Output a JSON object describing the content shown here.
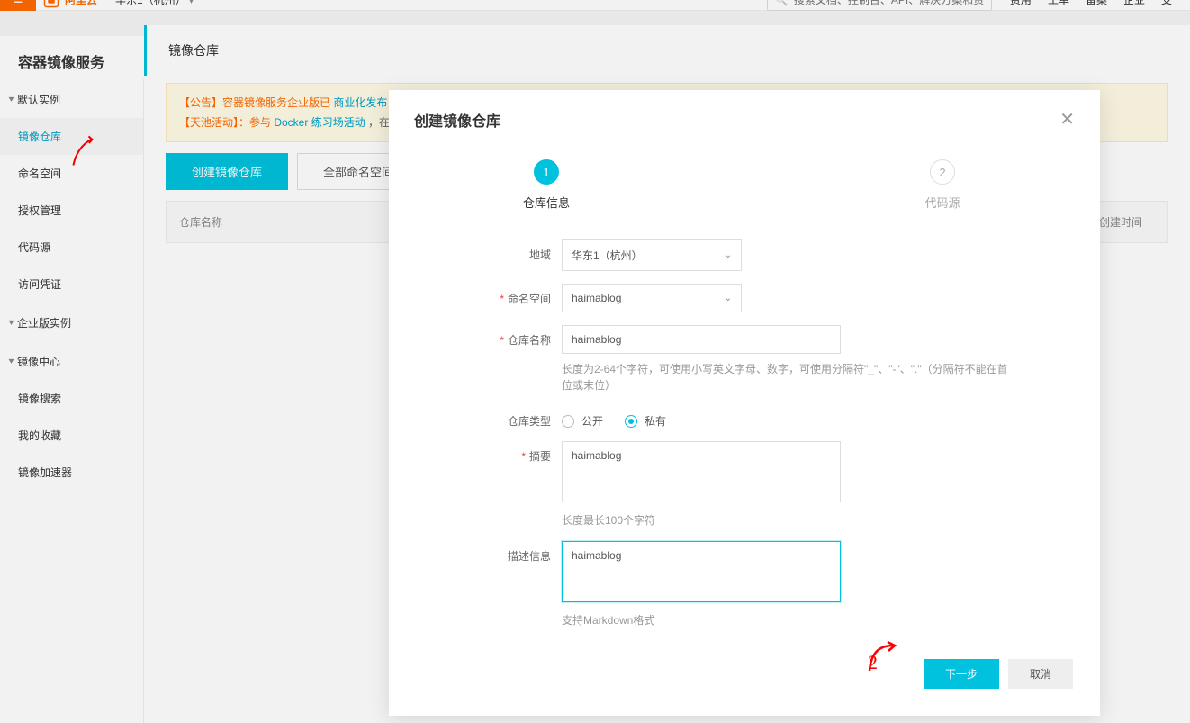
{
  "top": {
    "brand": "阿里云",
    "region": "华东1（杭州）",
    "search_placeholder": "搜索文档、控制台、API、解决方案和资源",
    "links": [
      "费用",
      "工单",
      "备案",
      "企业",
      "支"
    ]
  },
  "sidebar": {
    "service_title": "容器镜像服务",
    "group_default": "默认实例",
    "items_default": [
      "镜像仓库",
      "命名空间",
      "授权管理",
      "代码源",
      "访问凭证"
    ],
    "group_enterprise": "企业版实例",
    "group_center": "镜像中心",
    "items_center": [
      "镜像搜索",
      "我的收藏",
      "镜像加速器"
    ]
  },
  "main": {
    "page_title": "镜像仓库",
    "notice_line1_pre": "【公告】容器镜像服务企业版已",
    "notice_line1_link": "商业化发布",
    "notice_line1_post": "，",
    "notice_line2_pre": "【天池活动】：参与 ",
    "notice_line2_link": "Docker 练习场活动",
    "notice_line2_post": "，在",
    "tab_create": "创建镜像仓库",
    "tab_all_ns": "全部命名空间",
    "col_repo_name": "仓库名称",
    "col_ctime": "创建时间"
  },
  "modal": {
    "title": "创建镜像仓库",
    "step1": "仓库信息",
    "step2": "代码源",
    "labels": {
      "region": "地域",
      "namespace": "命名空间",
      "repo_name": "仓库名称",
      "repo_type": "仓库类型",
      "summary": "摘要",
      "description": "描述信息"
    },
    "values": {
      "region": "华东1（杭州）",
      "namespace": "haimablog",
      "repo_name": "haimablog",
      "repo_type_public": "公开",
      "repo_type_private": "私有",
      "summary": "haimablog",
      "description": "haimablog"
    },
    "helpers": {
      "repo_name_rule": "长度为2-64个字符，可使用小写英文字母、数字，可使用分隔符\"_\"、\"-\"、\".\"（分隔符不能在首位或末位）",
      "summary_rule": "长度最长100个字符",
      "desc_rule": "支持Markdown格式"
    },
    "buttons": {
      "next": "下一步",
      "cancel": "取消"
    }
  }
}
